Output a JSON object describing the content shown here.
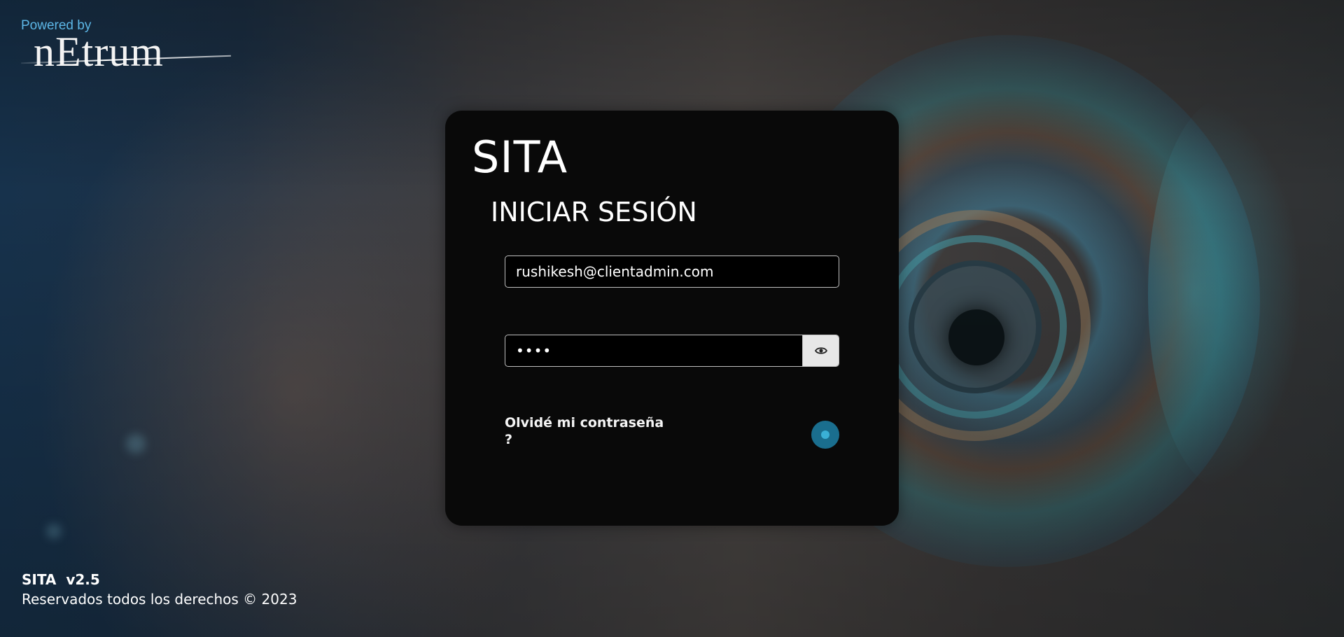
{
  "brand": {
    "powered_by": "Powered by",
    "logo_text": "nEtrum"
  },
  "login": {
    "app_title": "SITA",
    "form_title": "INICIAR SESIÓN",
    "email_value": "rushikesh@clientadmin.com",
    "password_value": "••••",
    "show_password_icon": "eye-icon",
    "forgot_password": "Olvidé mi contraseña ?",
    "loading_indicator": "spinner-icon"
  },
  "footer": {
    "version": "SITA  v2.5",
    "rights": "Reservados todos los derechos © 2023"
  },
  "colors": {
    "card_background": "#090909",
    "accent": "#1a6e8e",
    "powered_by": "#5cb6e6"
  }
}
